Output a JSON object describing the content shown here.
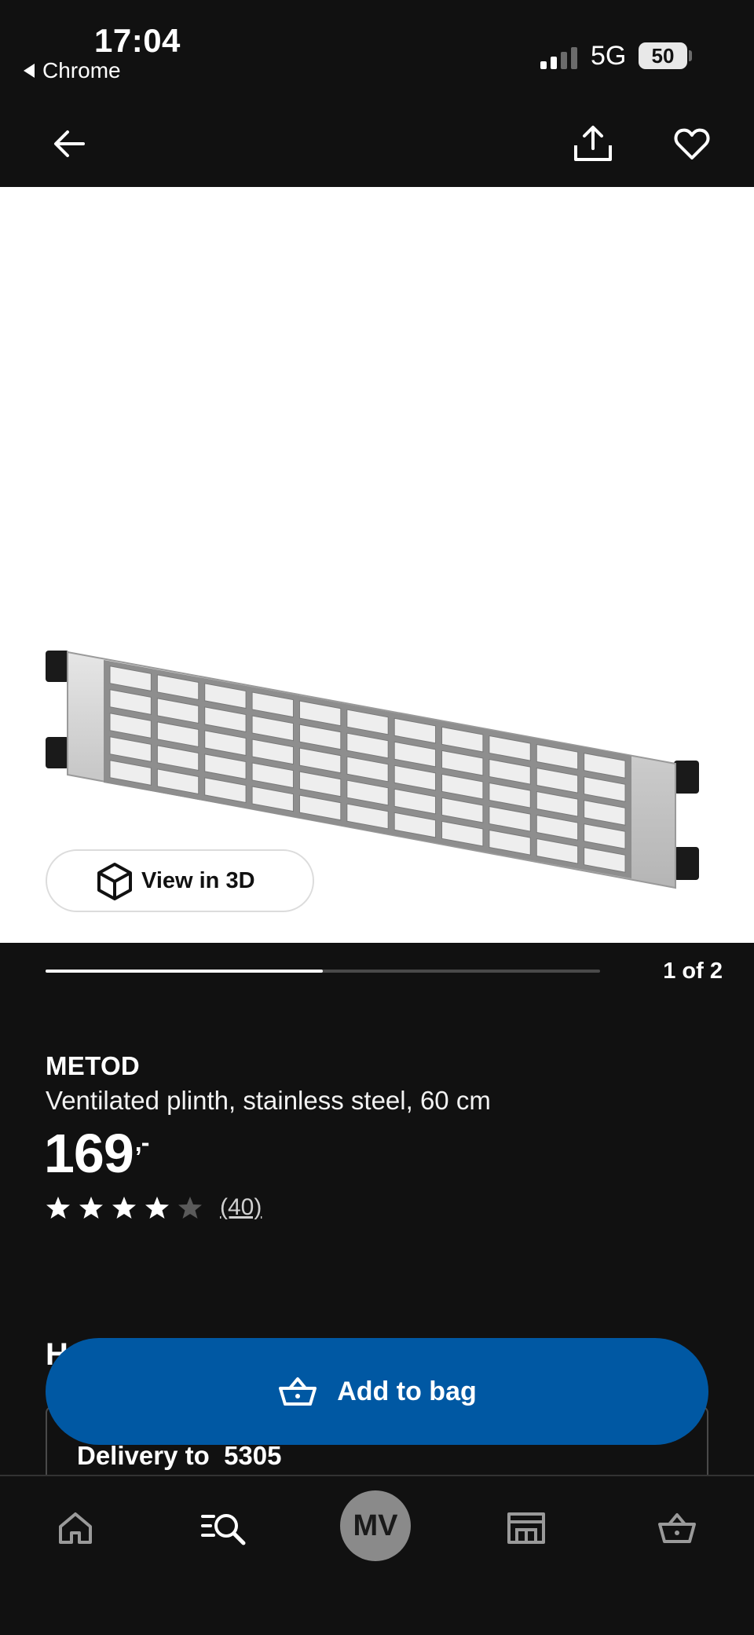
{
  "status_bar": {
    "time": "17:04",
    "back_app": "Chrome",
    "network": "5G",
    "battery": "50"
  },
  "product": {
    "brand": "METOD",
    "description": "Ventilated plinth, stainless steel, 60 cm",
    "price": "169",
    "price_suffix": ",-",
    "rating_stars": 4,
    "rating_max": 5,
    "review_count": "(40)"
  },
  "gallery": {
    "view_3d_label": "View in 3D",
    "pager": "1 of 2",
    "current": 1,
    "total": 2
  },
  "section_peek": "H",
  "delivery": {
    "label": "Delivery to",
    "postcode": "5305",
    "text": "Delivery to  5305"
  },
  "cta": {
    "add_to_bag_label": "Add to bag"
  },
  "bottom_nav": {
    "profile_initials": "MV"
  },
  "colors": {
    "background": "#111111",
    "primary_button": "#0058a3",
    "text": "#ffffff",
    "star_filled": "#ffffff",
    "star_empty": "#5a5a5a"
  },
  "icons": {
    "back": "arrow-left-icon",
    "share": "share-icon",
    "favorite": "heart-icon",
    "view_3d": "cube-icon",
    "bag": "basket-icon",
    "home": "home-icon",
    "search": "search-icon",
    "store": "store-icon",
    "cart": "cart-icon"
  }
}
